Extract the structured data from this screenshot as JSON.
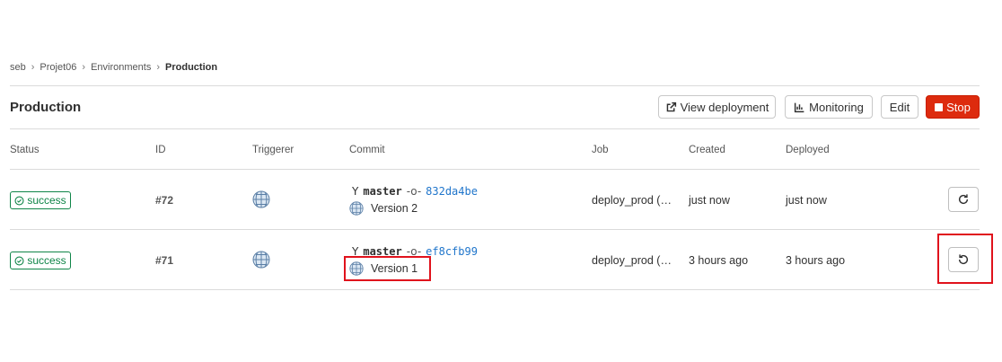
{
  "breadcrumb": {
    "items": [
      "seb",
      "Projet06",
      "Environments"
    ],
    "current": "Production"
  },
  "page": {
    "title": "Production"
  },
  "toolbar": {
    "view_deployment": "View deployment",
    "monitoring": "Monitoring",
    "edit": "Edit",
    "stop": "Stop"
  },
  "table": {
    "headers": {
      "status": "Status",
      "id": "ID",
      "triggerer": "Triggerer",
      "commit": "Commit",
      "job": "Job",
      "created": "Created",
      "deployed": "Deployed"
    },
    "rows": [
      {
        "status": "success",
        "id": "#72",
        "branch": "master",
        "sha": "832da4be",
        "message": "Version 2",
        "job": "deploy_prod (…",
        "created": "just now",
        "deployed": "just now",
        "action_icon": "redeploy-icon"
      },
      {
        "status": "success",
        "id": "#71",
        "branch": "master",
        "sha": "ef8cfb99",
        "message": "Version 1",
        "job": "deploy_prod (…",
        "created": "3 hours ago",
        "deployed": "3 hours ago",
        "action_icon": "rollback-icon"
      }
    ]
  },
  "colors": {
    "success": "#108548",
    "danger": "#dd2b0e",
    "link": "#1f75cb",
    "highlight": "#e0121c"
  }
}
